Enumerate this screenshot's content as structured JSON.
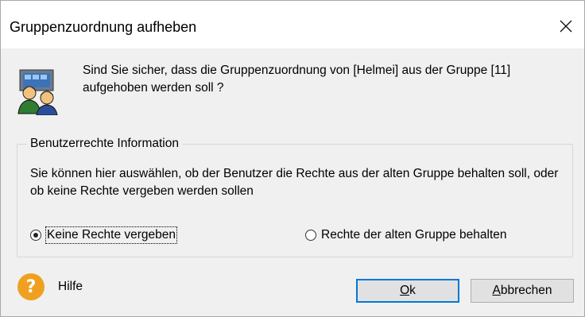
{
  "window": {
    "title": "Gruppenzuordnung aufheben",
    "close_icon": "close-icon"
  },
  "message": {
    "icon": "users-icon",
    "text": "Sind Sie sicher, dass die Gruppenzuordnung von [Helmei] aus der Gruppe [11] aufgehoben werden soll ?"
  },
  "groupbox": {
    "legend": "Benutzerrechte Information",
    "description": "Sie können hier auswählen, ob der Benutzer die Rechte aus der alten Gruppe behalten soll, oder ob keine Rechte vergeben werden sollen",
    "options": [
      {
        "label": "Keine Rechte vergeben",
        "checked": true
      },
      {
        "label": "Rechte der alten Gruppe behalten",
        "checked": false
      }
    ]
  },
  "footer": {
    "help_icon": "help-icon",
    "help_glyph": "?",
    "help_label": "Hilfe",
    "ok_accel": "O",
    "ok_rest": "k",
    "cancel_accel": "A",
    "cancel_rest": "bbrechen"
  }
}
